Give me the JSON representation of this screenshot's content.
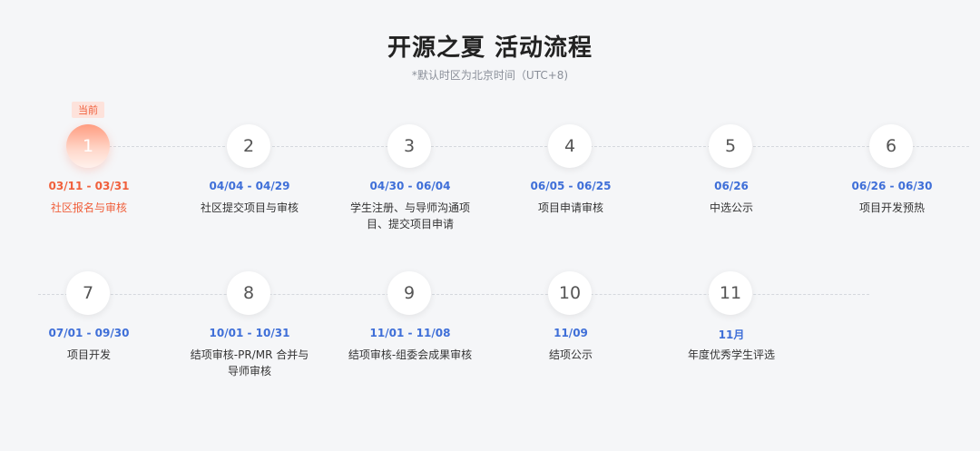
{
  "header": {
    "title": "开源之夏 活动流程",
    "subtitle": "*默认时区为北京时间（UTC+8)"
  },
  "current_badge": "当前",
  "steps": [
    {
      "num": "1",
      "date": "03/11 - 03/31",
      "label": "社区报名与审核"
    },
    {
      "num": "2",
      "date": "04/04 - 04/29",
      "label": "社区提交项目与审核"
    },
    {
      "num": "3",
      "date": "04/30 - 06/04",
      "label": "学生注册、与导师沟通项目、提交项目申请"
    },
    {
      "num": "4",
      "date": "06/05 - 06/25",
      "label": "项目申请审核"
    },
    {
      "num": "5",
      "date": "06/26",
      "label": "中选公示"
    },
    {
      "num": "6",
      "date": "06/26 - 06/30",
      "label": "项目开发预热"
    },
    {
      "num": "7",
      "date": "07/01 - 09/30",
      "label": "项目开发"
    },
    {
      "num": "8",
      "date": "10/01 - 10/31",
      "label": "结项审核-PR/MR 合并与导师审核"
    },
    {
      "num": "9",
      "date": "11/01 - 11/08",
      "label": "结项审核-组委会成果审核"
    },
    {
      "num": "10",
      "date": "11/09",
      "label": "结项公示"
    },
    {
      "num": "11",
      "date": "11月",
      "label": "年度优秀学生评选"
    }
  ],
  "colors": {
    "active": "#f0603c",
    "date": "#3f6fd8",
    "background": "#f5f6f8"
  }
}
